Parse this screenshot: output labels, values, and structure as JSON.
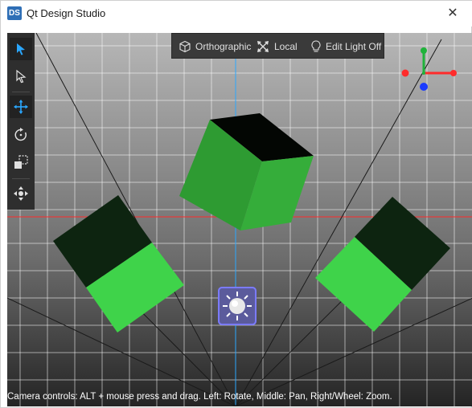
{
  "window": {
    "app_icon_text": "DS",
    "title": "Qt Design Studio",
    "close_glyph": "✕"
  },
  "toolbar": {
    "items": [
      {
        "label": "Orthographic",
        "icon": "cube-icon"
      },
      {
        "label": "Local",
        "icon": "local-transform-icon"
      },
      {
        "label": "Edit Light Off",
        "icon": "light-bulb-icon"
      }
    ]
  },
  "tools": [
    {
      "icon": "select-group-arrow-icon",
      "active": true
    },
    {
      "icon": "select-item-arrow-icon",
      "active": false
    },
    {
      "icon": "move-icon",
      "active": false
    },
    {
      "icon": "rotate-icon",
      "active": false
    },
    {
      "icon": "scale-icon",
      "active": false
    },
    {
      "icon": "fit-view-icon",
      "active": false
    }
  ],
  "status": {
    "text": "Camera controls: ALT + mouse press and drag. Left: Rotate, Middle: Pan, Right/Wheel: Zoom."
  },
  "colors": {
    "accent": "#2aa7ff",
    "cube_dark": "#0d2410",
    "cube_mid": "#2e9b32",
    "cube_light": "#3fd34a",
    "axis_x": "#ff2b2b",
    "axis_y": "#1fb33a",
    "axis_z": "#1b3bff",
    "light_frame": "#6a6aff"
  }
}
